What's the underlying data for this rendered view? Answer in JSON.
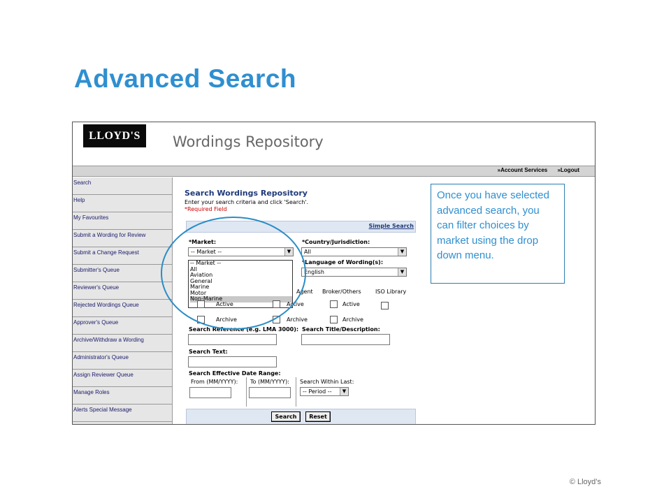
{
  "slide": {
    "title": "Advanced Search",
    "copyright": "© Lloyd’s",
    "callout": "Once you have selected advanced search, you can filter choices by market using the drop down menu."
  },
  "app": {
    "logo": "LLOYD'S",
    "title": "Wordings Repository",
    "top_links": {
      "account": "»Account Services",
      "logout": "»Logout"
    }
  },
  "sidebar": {
    "items": [
      {
        "label": "Search"
      },
      {
        "label": "Help"
      },
      {
        "label": "My Favourites"
      },
      {
        "label": "Submit a Wording for Review"
      },
      {
        "label": "Submit a Change Request"
      },
      {
        "label": "Submitter's Queue"
      },
      {
        "label": "Reviewer's Queue"
      },
      {
        "label": "Rejected Wordings Queue"
      },
      {
        "label": "Approver's Queue"
      },
      {
        "label": "Archive/Withdraw a Wording"
      },
      {
        "label": "Administrator's Queue"
      },
      {
        "label": "Assign Reviewer Queue"
      },
      {
        "label": "Manage Roles"
      },
      {
        "label": "Alerts Special Message"
      }
    ]
  },
  "form": {
    "title": "Search Wordings Repository",
    "subtitle": "Enter your search criteria and click 'Search'.",
    "required_note": "*Required Field",
    "simple_search": "Simple Search",
    "market": {
      "label": "*Market:",
      "value": "-- Market --",
      "options": [
        "-- Market --",
        "All",
        "Aviation",
        "General",
        "Marine",
        "Motor",
        "Non-Marine"
      ],
      "highlighted": "Non-Marine"
    },
    "country": {
      "label": "*Country/Jurisdiction:",
      "value": "All"
    },
    "language": {
      "label": "*Language of Wording(s):",
      "value": "English"
    },
    "sources": [
      "Agent",
      "Broker/Others",
      "ISO Library"
    ],
    "active_label": "Active",
    "archive_label": "Archive",
    "search_reference": "Search Reference (e.g. LMA 3000):",
    "search_title": "Search Title/Description:",
    "search_text": "Search Text:",
    "date_range": "Search Effective Date Range:",
    "from_label": "From (MM/YYYY):",
    "to_label": "To (MM/YYYY):",
    "within_label": "Search Within Last:",
    "period_value": "-- Period --",
    "search_button": "Search",
    "reset_button": "Reset"
  }
}
